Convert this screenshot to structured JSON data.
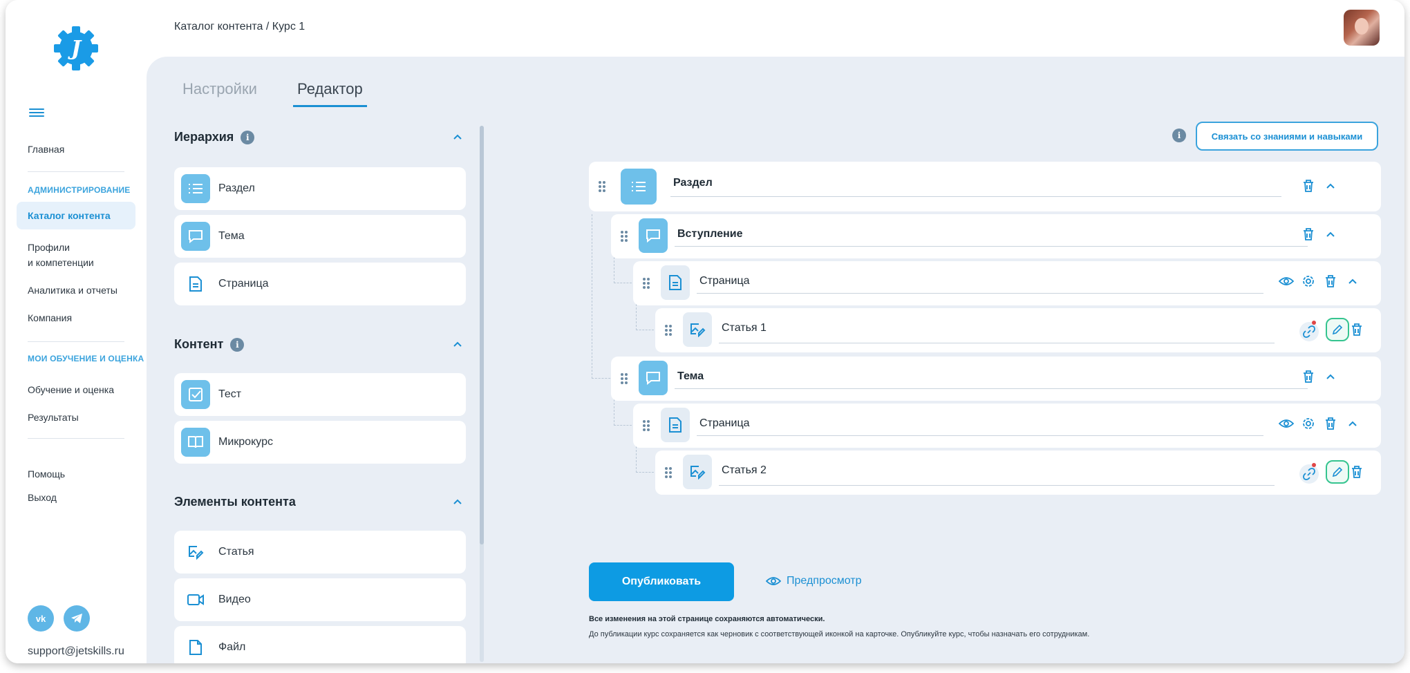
{
  "breadcrumb": "Каталог контента / Курс 1",
  "sidebar": {
    "home": "Главная",
    "admin_header": "АДМИНИСТРИРОВАНИЕ",
    "catalog": "Каталог контента",
    "profiles_line1": "Профили",
    "profiles_line2": "и компетенции",
    "analytics": "Аналитика и отчеты",
    "company": "Компания",
    "learning_header": "МОИ ОБУЧЕНИЕ И ОЦЕНКА",
    "learning": "Обучение и оценка",
    "results": "Результаты",
    "help": "Помощь",
    "logout": "Выход",
    "support_email": "support@jetskills.ru"
  },
  "tabs": {
    "settings": "Настройки",
    "editor": "Редактор"
  },
  "library": {
    "hierarchy_title": "Иерархия",
    "hierarchy_items": [
      "Раздел",
      "Тема",
      "Страница"
    ],
    "content_title": "Контент",
    "content_items": [
      "Тест",
      "Микрокурс"
    ],
    "elements_title": "Элементы контента",
    "element_items": [
      "Статья",
      "Видео",
      "Файл"
    ]
  },
  "link_button": "Связать со знаниями и навыками",
  "tree": {
    "section": "Раздел",
    "intro": "Вступление",
    "page1": "Страница",
    "article1": "Статья 1",
    "topic": "Тема",
    "page2": "Страница",
    "article2": "Статья 2"
  },
  "publish_button": "Опубликовать",
  "preview_link": "Предпросмотр",
  "note_bold": "Все изменения на этой странице сохраняются автоматически.",
  "note": "До публикации курс сохраняется как черновик с соответствующей иконкой на карточке. Опубликуйте курс, чтобы назначать его сотрудникам.",
  "colors": {
    "accent": "#1a8fd3",
    "primary_button": "#0d9be3",
    "edit_highlight": "#35c48f",
    "background": "#e9eef5"
  },
  "icons": [
    "menu-icon",
    "info-icon",
    "chevron-up-icon",
    "list-icon",
    "chat-icon",
    "document-icon",
    "checkbox-icon",
    "book-icon",
    "image-edit-icon",
    "video-icon",
    "file-icon",
    "drag-icon",
    "trash-icon",
    "eye-icon",
    "gear-icon",
    "link-icon",
    "pencil-icon",
    "vk-icon",
    "telegram-icon"
  ]
}
